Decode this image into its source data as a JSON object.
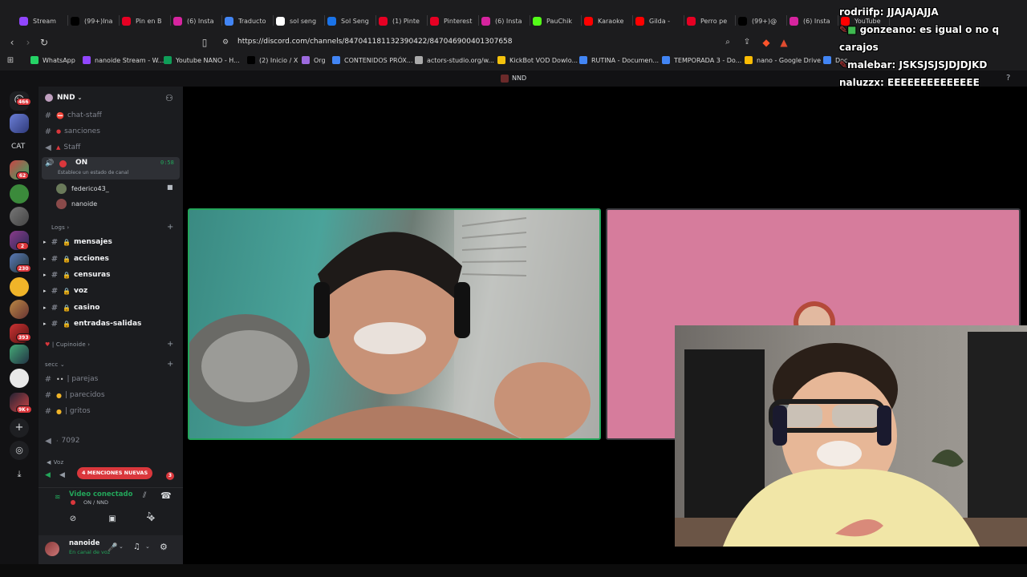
{
  "browser": {
    "tabs": [
      {
        "label": "Stream",
        "color": "#9146ff"
      },
      {
        "label": "(99+)Ina",
        "color": "#000000"
      },
      {
        "label": "Pin en B",
        "color": "#e60023"
      },
      {
        "label": "(6) Insta",
        "color": "#d6249f"
      },
      {
        "label": "Traducto",
        "color": "#4285f4"
      },
      {
        "label": "sol seng",
        "color": "#ffffff"
      },
      {
        "label": "Sol Seng",
        "color": "#1a73e8"
      },
      {
        "label": "(1) Pinte",
        "color": "#e60023"
      },
      {
        "label": "Pinterest",
        "color": "#e60023"
      },
      {
        "label": "(6) Insta",
        "color": "#d6249f"
      },
      {
        "label": "PauChik",
        "color": "#53fc18"
      },
      {
        "label": "Karaoke",
        "color": "#ff0000"
      },
      {
        "label": "Gilda - ",
        "color": "#ff0000"
      },
      {
        "label": "Perro pe",
        "color": "#e60023"
      },
      {
        "label": "(99+)@",
        "color": "#000000"
      },
      {
        "label": "(6) Insta",
        "color": "#d6249f"
      },
      {
        "label": "YouTube",
        "color": "#ff0000"
      }
    ],
    "url": "https://discord.com/channels/847041181132390422/847046900401307658",
    "bookmarks": [
      {
        "label": "WhatsApp",
        "color": "#25d366"
      },
      {
        "label": "nanoide Stream - W...",
        "color": "#9146ff"
      },
      {
        "label": "Youtube NANO - H...",
        "color": "#0f9d58"
      },
      {
        "label": "(2) Inicio / X",
        "color": "#000000"
      },
      {
        "label": "Org",
        "color": "#9c6ade"
      },
      {
        "label": "CONTENIDOS PRÓX...",
        "color": "#4285f4"
      },
      {
        "label": "actors-studio.org/w...",
        "color": "#aaaaaa"
      },
      {
        "label": "KickBot VOD Dowlo...",
        "color": "#f4c20d"
      },
      {
        "label": "RUTINA - Documen...",
        "color": "#4285f4"
      },
      {
        "label": "TEMPORADA 3 - Do...",
        "color": "#4285f4"
      },
      {
        "label": "nano - Google Drive",
        "color": "#fbbc04"
      },
      {
        "label": "Doc",
        "color": "#4285f4"
      }
    ]
  },
  "discord": {
    "top_title": "NND",
    "rail": {
      "badges": [
        "466",
        "62",
        "2",
        "230",
        "393",
        "9K+"
      ],
      "cat_label": "CAT"
    },
    "server_name": "NND",
    "channels_top": [
      {
        "name": "chat-staff"
      },
      {
        "name": "sanciones"
      },
      {
        "name": "Staff"
      }
    ],
    "voice_channel": {
      "name": "ON",
      "time": "0:58",
      "status": "Establece un estado de canal",
      "users": [
        "federico43_",
        "nanoide"
      ]
    },
    "logs_category": "Logs",
    "log_channels": [
      "mensajes",
      "acciones",
      "censuras",
      "voz",
      "casino",
      "entradas-salidas"
    ],
    "cupinoide_category": "| Cupinoide",
    "secc_category": "secc",
    "secc_channels": [
      "| parejas",
      "| parecidos",
      "| gritos"
    ],
    "voice_7092": "7092",
    "voz_category": "Voz",
    "mentions_badge": "4 MENCIONES NUEVAS",
    "mentions_count": "3",
    "voice_connected": "Video conectado",
    "voice_connected_sub": "ON / NND",
    "user_name": "nanoide",
    "user_status": "En canal de voz"
  },
  "chat": [
    {
      "user": "rodriifp",
      "text": "JJAJAJAJJA"
    },
    {
      "user": "gonzeano",
      "text": "es igual o no q carajos"
    },
    {
      "user": "malebar",
      "text": "JSKSJSJSJDJDJKD"
    },
    {
      "user": "naluzzx",
      "text": "EEEEEEEEEEEEEE"
    }
  ]
}
